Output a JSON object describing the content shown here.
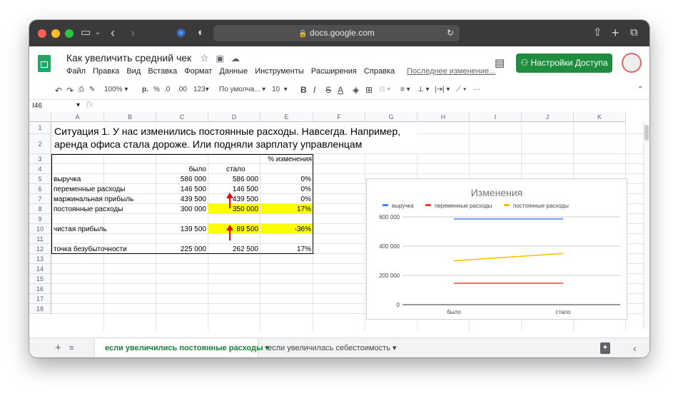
{
  "browser": {
    "url": "docs.google.com",
    "lock_icon": "lock-icon"
  },
  "doc": {
    "title": "Как увеличить средний чек",
    "menu": [
      "Файл",
      "Правка",
      "Вид",
      "Вставка",
      "Формат",
      "Данные",
      "Инструменты",
      "Расширения",
      "Справка"
    ],
    "last_edit": "Последнее изменение...",
    "share_label": "Настройки Доступа"
  },
  "toolbar": {
    "zoom": "100%",
    "currency": "р.",
    "percent": "%",
    "dec_less": ".0",
    "dec_more": ".00",
    "format_more": "123",
    "font": "По умолча...",
    "font_size": "10",
    "bold": "B",
    "italic": "I",
    "strike": "S",
    "textcolor": "A",
    "more": "···"
  },
  "formula_bar": {
    "cell_ref": "I46",
    "fx": "fx"
  },
  "columns": [
    "A",
    "B",
    "C",
    "D",
    "E",
    "F",
    "G",
    "H",
    "I",
    "J",
    "K"
  ],
  "rows": [
    "1",
    "2",
    "3",
    "4",
    "5",
    "6",
    "7",
    "8",
    "9",
    "10",
    "11",
    "12",
    "13",
    "14",
    "15",
    "16",
    "17",
    "18"
  ],
  "sheet": {
    "title_line1": "Ситуация 1. У нас изменились постоянные расходы. Навсегда. Например,",
    "title_line2": "аренда офиса стала дороже. Или подняли зарплату управленцам",
    "header_pct": "% изменения",
    "header_before": "было",
    "header_after": "стало",
    "table": [
      {
        "label": "выручка",
        "before": "586 000",
        "after": "586 000",
        "pct": "0%"
      },
      {
        "label": "переменные расходы",
        "before": "146 500",
        "after": "146 500",
        "pct": "0%"
      },
      {
        "label": "маржинальная прибыль",
        "before": "439 500",
        "after": "439 500",
        "pct": "0%"
      },
      {
        "label": "постоянные расходы",
        "before": "300 000",
        "after": "350 000",
        "pct": "17%"
      },
      {
        "label": "чистая прибыль",
        "before": "139 500",
        "after": "89 500",
        "pct": "-36%"
      },
      {
        "label": "точка безубыточности",
        "before": "225 000",
        "after": "262 500",
        "pct": "17%"
      }
    ]
  },
  "chart_data": {
    "type": "line",
    "title": "Изменения",
    "categories": [
      "было",
      "стало"
    ],
    "series": [
      {
        "name": "выручка",
        "values": [
          586000,
          586000
        ],
        "color": "#4285f4"
      },
      {
        "name": "переменные расходы",
        "values": [
          146500,
          146500
        ],
        "color": "#ea4335"
      },
      {
        "name": "постоянные расходы",
        "values": [
          300000,
          350000
        ],
        "color": "#fbbc04"
      }
    ],
    "yticks": [
      "600 000",
      "400 000",
      "200 000",
      "0"
    ],
    "ylim": [
      0,
      600000
    ],
    "legend_position": "top",
    "grid": true
  },
  "tabs": {
    "tab1": "если увеличились постоянные расходы",
    "tab2": "если увеличилась себестоимость"
  }
}
